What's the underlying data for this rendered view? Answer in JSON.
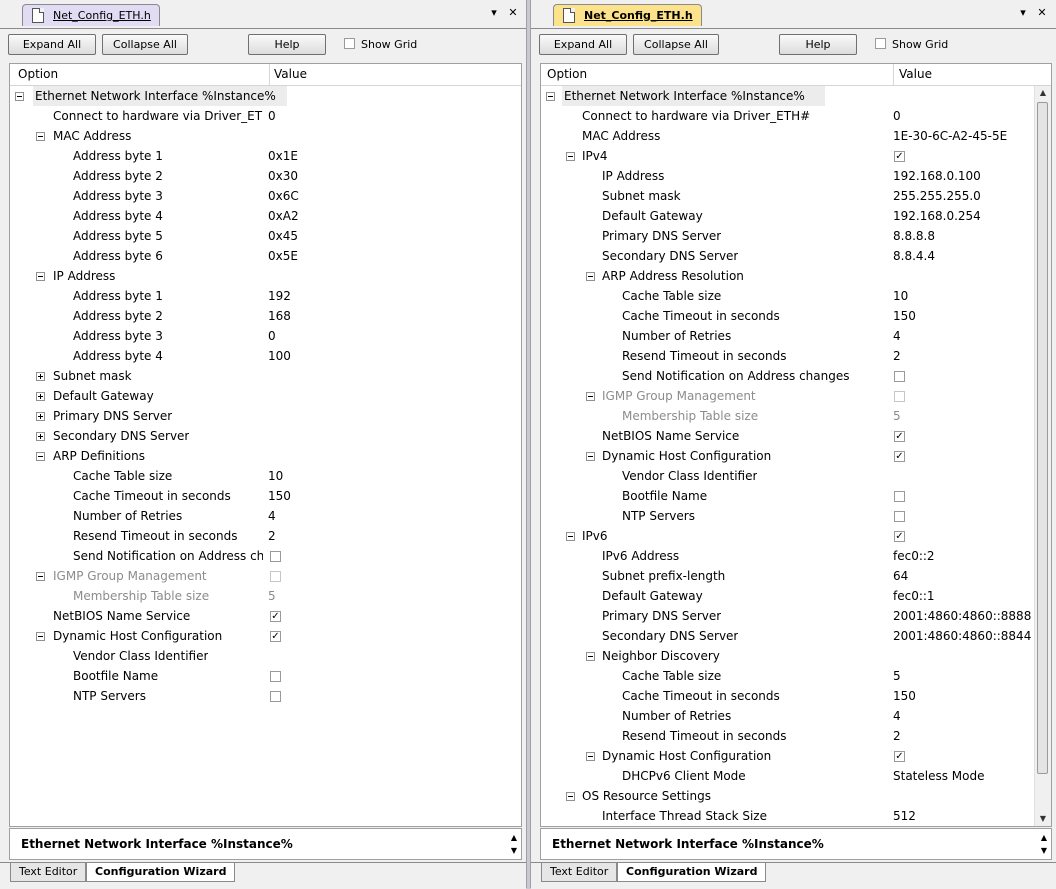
{
  "left_pane": {
    "tab_label": "Net_Config_ETH.h",
    "pin_label": "▾",
    "close_label": "✕",
    "buttons": {
      "expand": "Expand All",
      "collapse": "Collapse All",
      "help": "Help"
    },
    "show_grid_label": "Show Grid",
    "columns": {
      "option": "Option",
      "value": "Value"
    },
    "rows": [
      {
        "label": "Ethernet Network Interface %Instance%",
        "value": "",
        "level": 0,
        "toggle": "minus",
        "root": true
      },
      {
        "label": "Connect to hardware via Driver_ETH#",
        "value": "0",
        "level": 1
      },
      {
        "label": "MAC Address",
        "value": "",
        "level": 1,
        "toggle": "minus"
      },
      {
        "label": "Address byte 1",
        "value": "0x1E",
        "level": 2
      },
      {
        "label": "Address byte 2",
        "value": "0x30",
        "level": 2
      },
      {
        "label": "Address byte 3",
        "value": "0x6C",
        "level": 2
      },
      {
        "label": "Address byte 4",
        "value": "0xA2",
        "level": 2
      },
      {
        "label": "Address byte 5",
        "value": "0x45",
        "level": 2
      },
      {
        "label": "Address byte 6",
        "value": "0x5E",
        "level": 2
      },
      {
        "label": "IP Address",
        "value": "",
        "level": 1,
        "toggle": "minus"
      },
      {
        "label": "Address byte 1",
        "value": "192",
        "level": 2
      },
      {
        "label": "Address byte 2",
        "value": "168",
        "level": 2
      },
      {
        "label": "Address byte 3",
        "value": "0",
        "level": 2
      },
      {
        "label": "Address byte 4",
        "value": "100",
        "level": 2
      },
      {
        "label": "Subnet mask",
        "value": "",
        "level": 1,
        "toggle": "plus"
      },
      {
        "label": "Default Gateway",
        "value": "",
        "level": 1,
        "toggle": "plus"
      },
      {
        "label": "Primary DNS Server",
        "value": "",
        "level": 1,
        "toggle": "plus"
      },
      {
        "label": "Secondary DNS Server",
        "value": "",
        "level": 1,
        "toggle": "plus"
      },
      {
        "label": "ARP Definitions",
        "value": "",
        "level": 1,
        "toggle": "minus"
      },
      {
        "label": "Cache Table size",
        "value": "10",
        "level": 2
      },
      {
        "label": "Cache Timeout in seconds",
        "value": "150",
        "level": 2
      },
      {
        "label": "Number of Retries",
        "value": "4",
        "level": 2
      },
      {
        "label": "Resend Timeout in seconds",
        "value": "2",
        "level": 2
      },
      {
        "label": "Send Notification on Address cha...",
        "value": "",
        "level": 2,
        "checkbox": false
      },
      {
        "label": "IGMP Group Management",
        "value": "",
        "level": 1,
        "toggle": "minus",
        "checkbox": false,
        "disabled": true
      },
      {
        "label": "Membership Table size",
        "value": "5",
        "level": 2,
        "disabled": true
      },
      {
        "label": "NetBIOS Name Service",
        "value": "",
        "level": 1,
        "checkbox": true
      },
      {
        "label": "Dynamic Host Configuration",
        "value": "",
        "level": 1,
        "toggle": "minus",
        "checkbox": true
      },
      {
        "label": "Vendor Class Identifier",
        "value": "",
        "level": 2
      },
      {
        "label": "Bootfile Name",
        "value": "",
        "level": 2,
        "checkbox": false
      },
      {
        "label": "NTP Servers",
        "value": "",
        "level": 2,
        "checkbox": false
      }
    ],
    "description": "Ethernet Network Interface %Instance%",
    "bottom_tabs": [
      "Text Editor",
      "Configuration Wizard"
    ]
  },
  "right_pane": {
    "tab_label": "Net_Config_ETH.h",
    "pin_label": "▾",
    "close_label": "✕",
    "buttons": {
      "expand": "Expand All",
      "collapse": "Collapse All",
      "help": "Help"
    },
    "show_grid_label": "Show Grid",
    "columns": {
      "option": "Option",
      "value": "Value"
    },
    "rows": [
      {
        "label": "Ethernet Network Interface %Instance%",
        "value": "",
        "level": 0,
        "toggle": "minus",
        "root": true
      },
      {
        "label": "Connect to hardware via Driver_ETH#",
        "value": "0",
        "level": 1
      },
      {
        "label": "MAC Address",
        "value": "1E-30-6C-A2-45-5E",
        "level": 1
      },
      {
        "label": "IPv4",
        "value": "",
        "level": 1,
        "toggle": "minus",
        "checkbox": true
      },
      {
        "label": "IP Address",
        "value": "192.168.0.100",
        "level": 2
      },
      {
        "label": "Subnet mask",
        "value": "255.255.255.0",
        "level": 2
      },
      {
        "label": "Default Gateway",
        "value": "192.168.0.254",
        "level": 2
      },
      {
        "label": "Primary DNS Server",
        "value": "8.8.8.8",
        "level": 2
      },
      {
        "label": "Secondary DNS Server",
        "value": "8.8.4.4",
        "level": 2
      },
      {
        "label": "ARP Address Resolution",
        "value": "",
        "level": 2,
        "toggle": "minus"
      },
      {
        "label": "Cache Table size",
        "value": "10",
        "level": 3
      },
      {
        "label": "Cache Timeout in seconds",
        "value": "150",
        "level": 3
      },
      {
        "label": "Number of Retries",
        "value": "4",
        "level": 3
      },
      {
        "label": "Resend Timeout in seconds",
        "value": "2",
        "level": 3
      },
      {
        "label": "Send Notification on Address changes",
        "value": "",
        "level": 3,
        "checkbox": false
      },
      {
        "label": "IGMP Group Management",
        "value": "",
        "level": 2,
        "toggle": "minus",
        "checkbox": false,
        "disabled": true
      },
      {
        "label": "Membership Table size",
        "value": "5",
        "level": 3,
        "disabled": true
      },
      {
        "label": "NetBIOS Name Service",
        "value": "",
        "level": 2,
        "checkbox": true
      },
      {
        "label": "Dynamic Host Configuration",
        "value": "",
        "level": 2,
        "toggle": "minus",
        "checkbox": true
      },
      {
        "label": "Vendor Class Identifier",
        "value": "",
        "level": 3
      },
      {
        "label": "Bootfile Name",
        "value": "",
        "level": 3,
        "checkbox": false
      },
      {
        "label": "NTP Servers",
        "value": "",
        "level": 3,
        "checkbox": false
      },
      {
        "label": "IPv6",
        "value": "",
        "level": 1,
        "toggle": "minus",
        "checkbox": true
      },
      {
        "label": "IPv6 Address",
        "value": "fec0::2",
        "level": 2
      },
      {
        "label": "Subnet prefix-length",
        "value": "64",
        "level": 2
      },
      {
        "label": "Default Gateway",
        "value": "fec0::1",
        "level": 2
      },
      {
        "label": "Primary DNS Server",
        "value": "2001:4860:4860::8888",
        "level": 2
      },
      {
        "label": "Secondary DNS Server",
        "value": "2001:4860:4860::8844",
        "level": 2
      },
      {
        "label": "Neighbor Discovery",
        "value": "",
        "level": 2,
        "toggle": "minus"
      },
      {
        "label": "Cache Table size",
        "value": "5",
        "level": 3
      },
      {
        "label": "Cache Timeout in seconds",
        "value": "150",
        "level": 3
      },
      {
        "label": "Number of Retries",
        "value": "4",
        "level": 3
      },
      {
        "label": "Resend Timeout in seconds",
        "value": "2",
        "level": 3
      },
      {
        "label": "Dynamic Host Configuration",
        "value": "",
        "level": 2,
        "toggle": "minus",
        "checkbox": true
      },
      {
        "label": "DHCPv6 Client Mode",
        "value": "Stateless Mode",
        "level": 3
      },
      {
        "label": "OS Resource Settings",
        "value": "",
        "level": 1,
        "toggle": "minus"
      },
      {
        "label": "Interface Thread Stack Size",
        "value": "512",
        "level": 2
      }
    ],
    "description": "Ethernet Network Interface %Instance%",
    "bottom_tabs": [
      "Text Editor",
      "Configuration Wizard"
    ]
  }
}
